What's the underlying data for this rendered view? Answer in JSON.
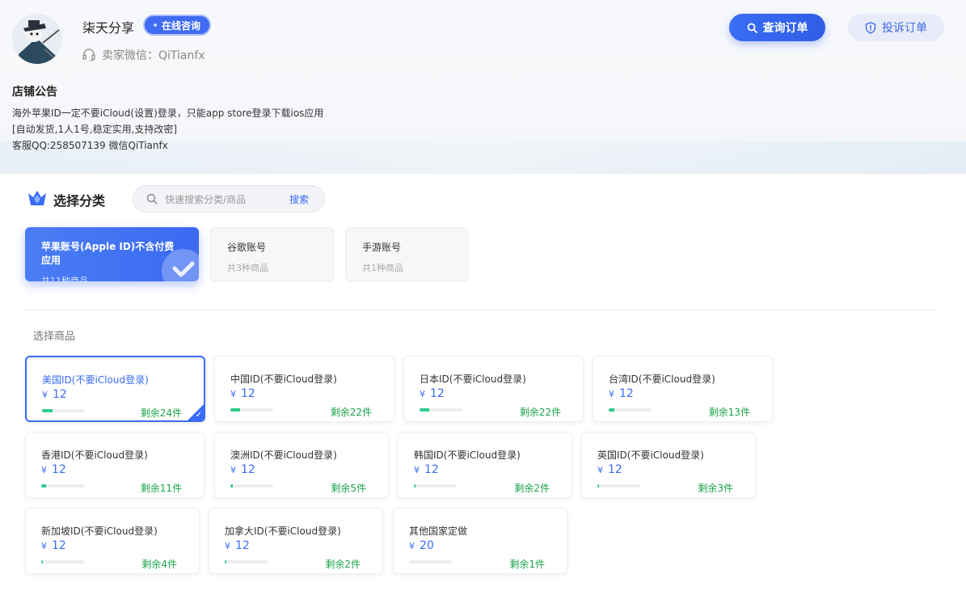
{
  "store": {
    "name": "柒天分享",
    "chat_label": "在线咨询",
    "wechat_label": "卖家微信：QiTianfx"
  },
  "actions": {
    "query_label": "查询订单",
    "complain_label": "投诉订单"
  },
  "notice": {
    "title": "店铺公告",
    "lines": [
      "海外苹果ID一定不要iCloud(设置)登录，只能app store登录下载ios应用",
      "[自动发货,1人1号,稳定实用,支持改密]",
      "客服QQ:258507139 微信QiTianfx"
    ]
  },
  "categories_section": {
    "title": "选择分类",
    "search_placeholder": "快速搜索分类/商品",
    "search_button": "搜索",
    "items": [
      {
        "name": "苹果账号(Apple ID)不含付费应用",
        "count": "共11种商品",
        "active": true
      },
      {
        "name": "谷歌账号",
        "count": "共3种商品",
        "active": false
      },
      {
        "name": "手游账号",
        "count": "共1种商品",
        "active": false
      }
    ]
  },
  "goods_section": {
    "title": "选择商品",
    "currency": "¥",
    "items": [
      {
        "name": "美国ID(不要iCloud登录)",
        "price": "12",
        "stock": "剩余24件",
        "level": 0.25,
        "active": true
      },
      {
        "name": "中国ID(不要iCloud登录)",
        "price": "12",
        "stock": "剩余22件",
        "level": 0.22
      },
      {
        "name": "日本ID(不要iCloud登录)",
        "price": "12",
        "stock": "剩余22件",
        "level": 0.22
      },
      {
        "name": "台湾ID(不要iCloud登录)",
        "price": "12",
        "stock": "剩余13件",
        "level": 0.13
      },
      {
        "name": "香港ID(不要iCloud登录)",
        "price": "12",
        "stock": "剩余11件",
        "level": 0.11
      },
      {
        "name": "澳洲ID(不要iCloud登录)",
        "price": "12",
        "stock": "剩余5件",
        "level": 0.05
      },
      {
        "name": "韩国ID(不要iCloud登录)",
        "price": "12",
        "stock": "剩余2件",
        "level": 0.02
      },
      {
        "name": "英国ID(不要iCloud登录)",
        "price": "12",
        "stock": "剩余3件",
        "level": 0.03
      },
      {
        "name": "新加坡ID(不要iCloud登录)",
        "price": "12",
        "stock": "剩余4件",
        "level": 0.04
      },
      {
        "name": "加拿大ID(不要iCloud登录)",
        "price": "12",
        "stock": "剩余2件",
        "level": 0.02
      },
      {
        "name": "其他国家定做",
        "price": "20",
        "stock": "剩余1件",
        "level": 0.0
      }
    ]
  },
  "colors": {
    "accent": "#3a6cf4",
    "stock_green": "#1aa34a",
    "bar_green": "#2ecc8a"
  }
}
